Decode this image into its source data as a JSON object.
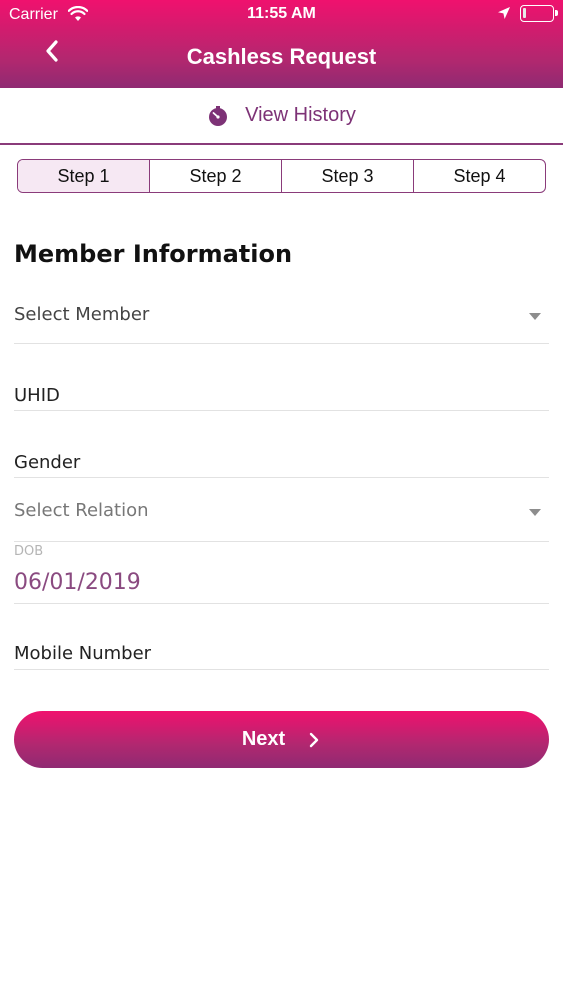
{
  "status_bar": {
    "carrier": "Carrier",
    "time": "11:55 AM",
    "icons": [
      "wifi-icon",
      "location-arrow-icon",
      "battery-icon"
    ]
  },
  "header": {
    "title": "Cashless Request",
    "back_icon": "chevron-left-icon"
  },
  "history": {
    "label": "View History",
    "icon": "stopwatch-icon"
  },
  "steps": [
    {
      "label": "Step 1",
      "active": true
    },
    {
      "label": "Step 2",
      "active": false
    },
    {
      "label": "Step 3",
      "active": false
    },
    {
      "label": "Step 4",
      "active": false
    }
  ],
  "form": {
    "section_title": "Member Information",
    "member": {
      "placeholder": "Select Member",
      "icon": "dropdown-arrow-icon"
    },
    "uhid": {
      "label": "UHID"
    },
    "gender": {
      "label": "Gender"
    },
    "relation": {
      "placeholder": "Select Relation",
      "icon": "dropdown-arrow-icon"
    },
    "dob": {
      "label": "DOB",
      "value": "06/01/2019"
    },
    "mobile": {
      "label": "Mobile Number"
    }
  },
  "next_button": {
    "label": "Next",
    "icon": "chevron-right-icon"
  },
  "colors": {
    "brand_pink": "#f0116e",
    "brand_purple": "#8f2a72",
    "accent_text": "#7d3276",
    "active_step_bg": "#f6e8f3"
  }
}
